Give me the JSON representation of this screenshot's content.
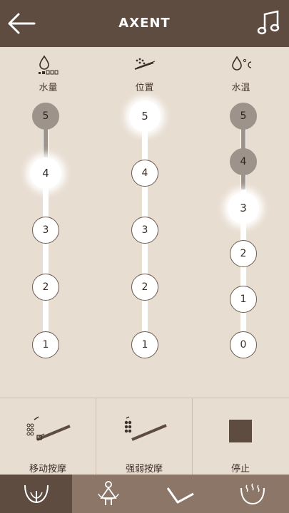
{
  "header": {
    "title": "AXENT"
  },
  "columns": [
    {
      "label": "水量",
      "levels": [
        "5",
        "4",
        "3",
        "2",
        "1"
      ],
      "active": "4",
      "filled": [
        "5"
      ]
    },
    {
      "label": "位置",
      "levels": [
        "5",
        "4",
        "3",
        "2",
        "1"
      ],
      "active": "5",
      "filled": []
    },
    {
      "label": "水温",
      "levels": [
        "5",
        "4",
        "3",
        "2",
        "1",
        "0"
      ],
      "active": "3",
      "filled": [
        "5",
        "4"
      ]
    }
  ],
  "modes": [
    {
      "label": "移动按摩",
      "icon": "moving-massage-icon"
    },
    {
      "label": "强弱按摩",
      "icon": "pulse-massage-icon"
    },
    {
      "label": "停止",
      "icon": "stop-icon"
    }
  ],
  "tabs": [
    {
      "icon": "rear-wash-icon",
      "selected": true
    },
    {
      "icon": "feminine-wash-icon",
      "selected": false
    },
    {
      "icon": "nozzle-icon",
      "selected": false
    },
    {
      "icon": "dryer-icon",
      "selected": false
    }
  ],
  "colors": {
    "header": "#5e4c41",
    "background": "#e8ddd1",
    "filled_node": "#9e938b",
    "tabbar": "#8c7668"
  }
}
